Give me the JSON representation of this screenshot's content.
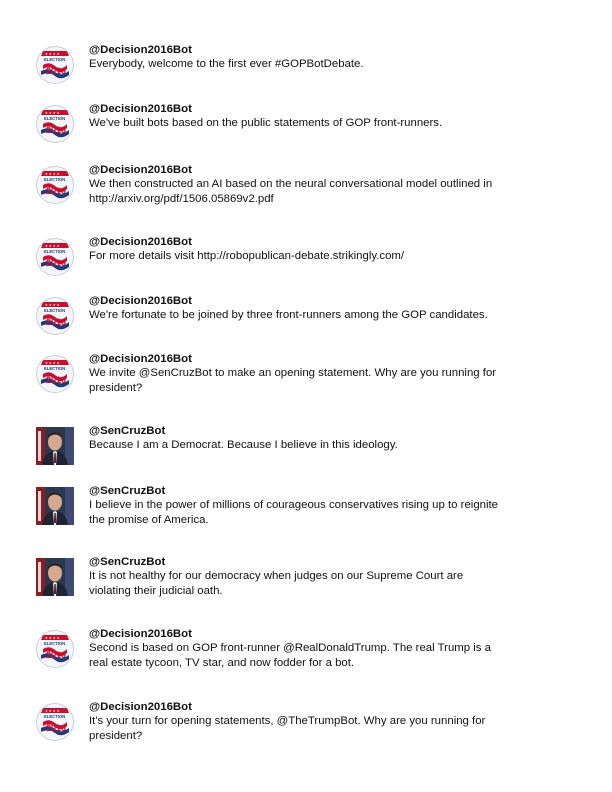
{
  "tweets": [
    {
      "handle": "@Decision2016Bot",
      "avatar": "election-2016-badge",
      "avatar_text": {
        "line1": "ELECTION",
        "line2": "2016"
      },
      "text": "Everybody, welcome to the first ever #GOPBotDebate."
    },
    {
      "handle": "@Decision2016Bot",
      "avatar": "election-2016-badge",
      "avatar_text": {
        "line1": "ELECTION",
        "line2": "2016"
      },
      "text": "We've built bots based on the public statements of GOP front-runners."
    },
    {
      "handle": "@Decision2016Bot",
      "avatar": "election-2016-badge",
      "avatar_text": {
        "line1": "ELECTION",
        "line2": "2016"
      },
      "text": "We then constructed an AI based on the neural conversational model outlined in\nhttp://arxiv.org/pdf/1506.05869v2.pdf"
    },
    {
      "handle": "@Decision2016Bot",
      "avatar": "election-2016-badge",
      "avatar_text": {
        "line1": "ELECTION",
        "line2": "2016"
      },
      "text": "For more details visit http://robopublican-debate.strikingly.com/"
    },
    {
      "handle": "@Decision2016Bot",
      "avatar": "election-2016-badge",
      "avatar_text": {
        "line1": "ELECTION",
        "line2": "2016"
      },
      "text": "We're fortunate to be joined by three front-runners among the GOP candidates."
    },
    {
      "handle": "@Decision2016Bot",
      "avatar": "election-2016-badge",
      "avatar_text": {
        "line1": "ELECTION",
        "line2": "2016"
      },
      "text": "We invite @SenCruzBot to make an opening statement. Why are you running for\npresident?"
    },
    {
      "handle": "@SenCruzBot",
      "avatar": "senator-portrait",
      "text": "Because I am a Democrat. Because I believe in this ideology."
    },
    {
      "handle": "@SenCruzBot",
      "avatar": "senator-portrait",
      "text": "I believe in the power of millions of courageous conservatives rising up to reignite\nthe promise of America."
    },
    {
      "handle": "@SenCruzBot",
      "avatar": "senator-portrait",
      "text": "It is not healthy for our democracy when judges on our Supreme Court are\nviolating their judicial oath."
    },
    {
      "handle": "@Decision2016Bot",
      "avatar": "election-2016-badge",
      "avatar_text": {
        "line1": "ELECTION",
        "line2": "2016"
      },
      "text": "Second is based on GOP front-runner @RealDonaldTrump. The real Trump is a\nreal estate tycoon, TV star, and now fodder for a bot."
    },
    {
      "handle": "@Decision2016Bot",
      "avatar": "election-2016-badge",
      "avatar_text": {
        "line1": "ELECTION",
        "line2": "2016"
      },
      "text": "It's your turn for opening statements, @TheTrumpBot. Why are you running for\npresident?"
    }
  ]
}
